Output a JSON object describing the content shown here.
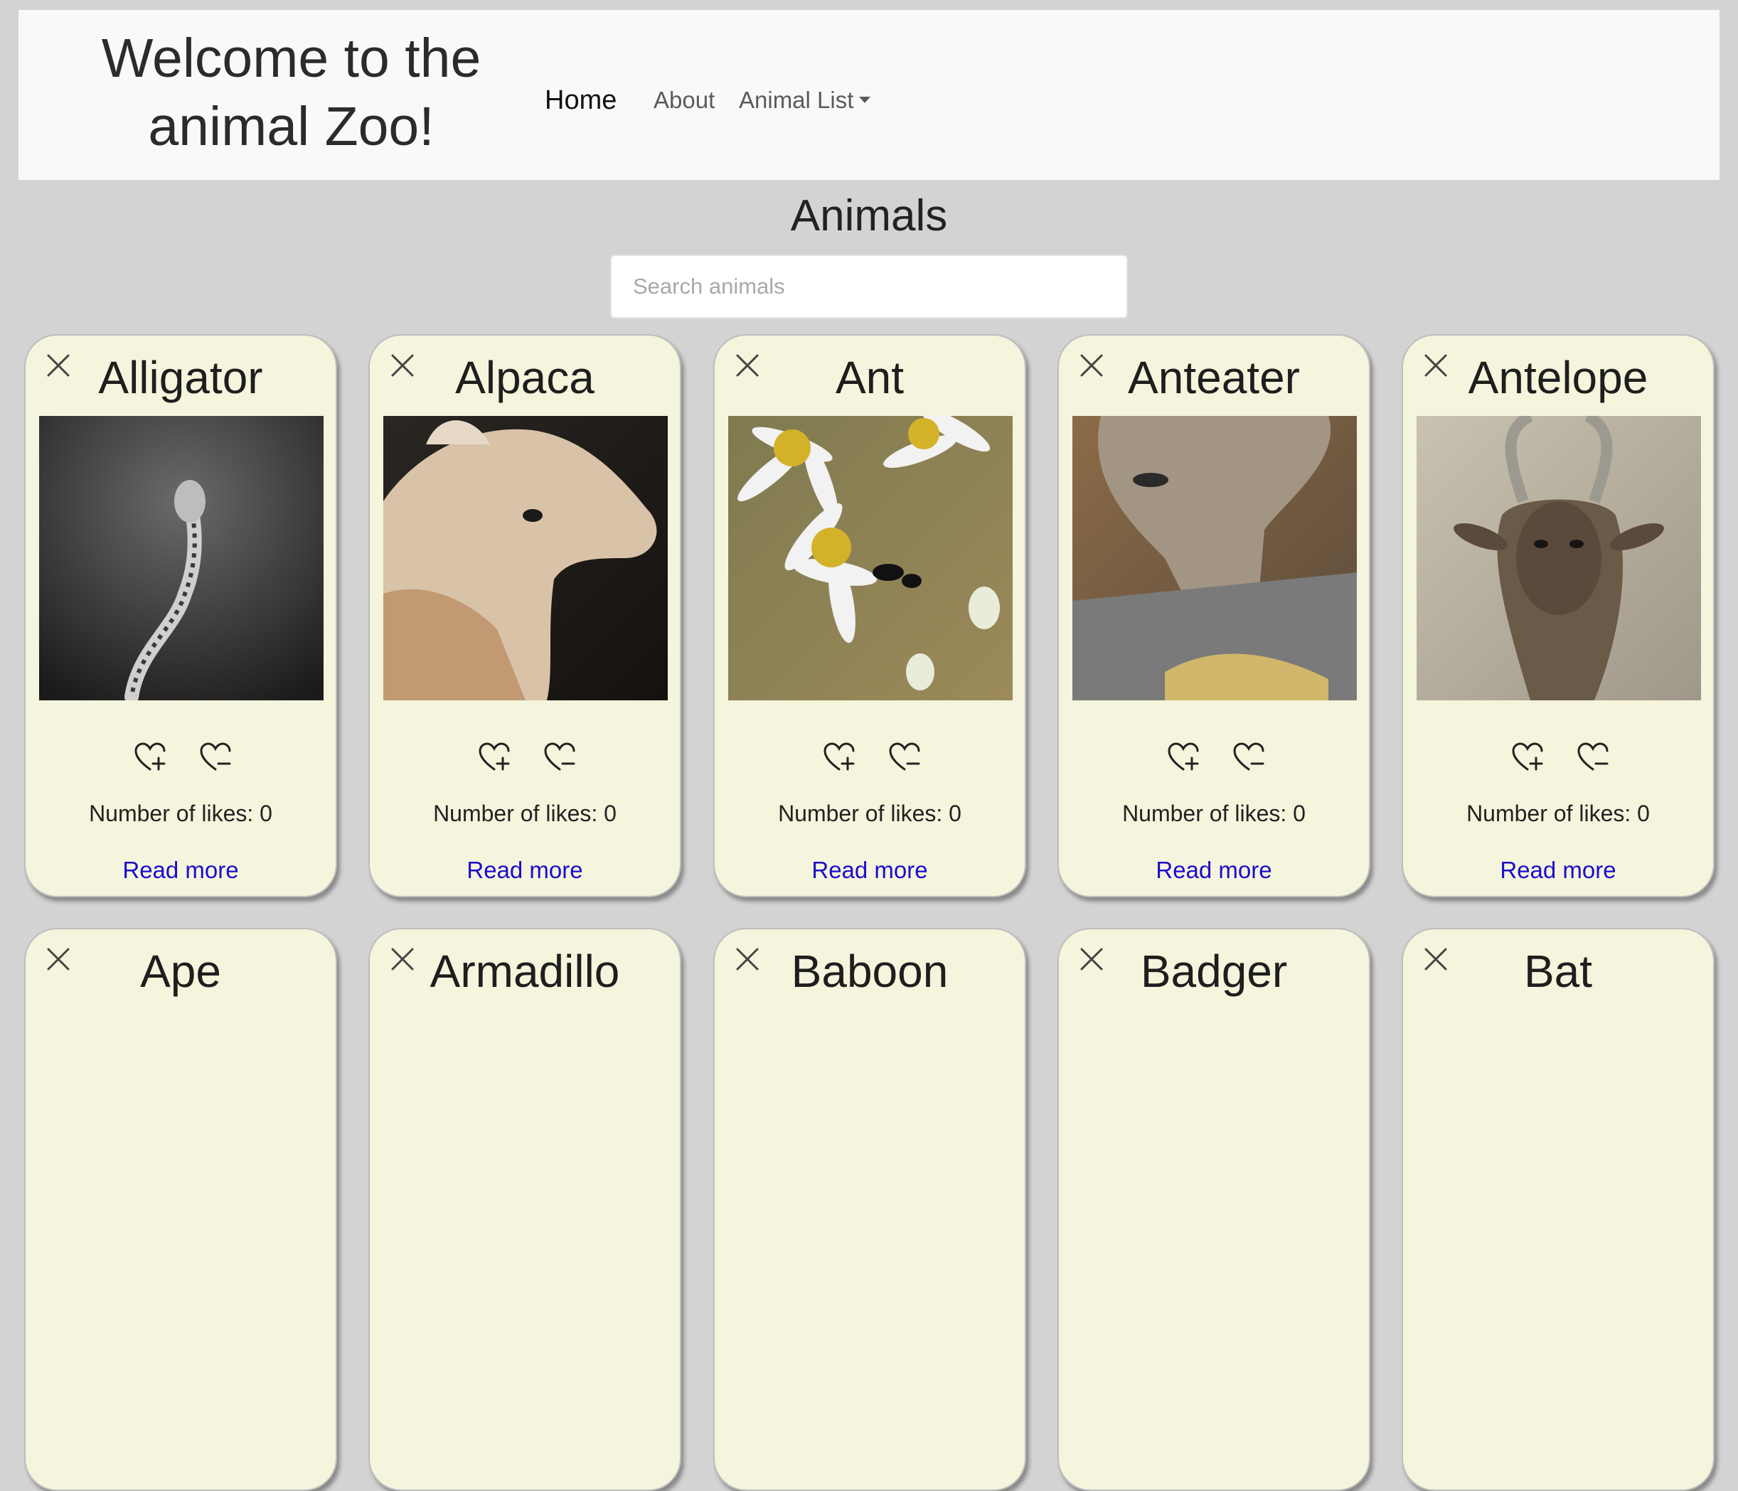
{
  "navbar": {
    "brand_line1": "Welcome to the",
    "brand_line2": "animal Zoo!",
    "links": [
      "Home",
      "About",
      "Animal List"
    ]
  },
  "page_title": "Animals",
  "search": {
    "placeholder": "Search animals",
    "value": ""
  },
  "cards": [
    {
      "name": "Alligator",
      "likes_label": "Number of likes:",
      "likes": 0,
      "read_more": "Read more"
    },
    {
      "name": "Alpaca",
      "likes_label": "Number of likes:",
      "likes": 0,
      "read_more": "Read more"
    },
    {
      "name": "Ant",
      "likes_label": "Number of likes:",
      "likes": 0,
      "read_more": "Read more"
    },
    {
      "name": "Anteater",
      "likes_label": "Number of likes:",
      "likes": 0,
      "read_more": "Read more"
    },
    {
      "name": "Antelope",
      "likes_label": "Number of likes:",
      "likes": 0,
      "read_more": "Read more"
    },
    {
      "name": "Ape"
    },
    {
      "name": "Armadillo"
    },
    {
      "name": "Baboon"
    },
    {
      "name": "Badger"
    },
    {
      "name": "Bat"
    }
  ],
  "colors": {
    "background": "#d3d3d3",
    "navbar": "#f8f9fa",
    "card": "#f5f4dc",
    "link": "#1a0dcc"
  }
}
